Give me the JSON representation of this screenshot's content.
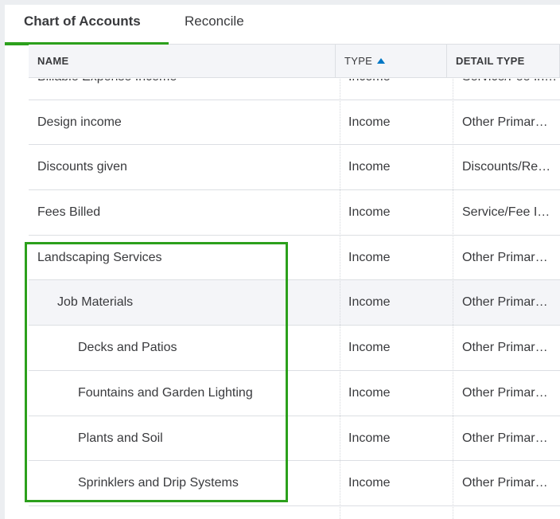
{
  "tabs": [
    {
      "label": "Chart of Accounts"
    },
    {
      "label": "Reconcile"
    }
  ],
  "table": {
    "columns": {
      "name": "NAME",
      "type": "TYPE",
      "detail_type": "DETAIL TYPE"
    },
    "rows": [
      {
        "name": "Billable Expense Income",
        "type": "Income",
        "detail": "Service/Fee Income"
      },
      {
        "name": "Design income",
        "type": "Income",
        "detail": "Other Primar…"
      },
      {
        "name": "Discounts given",
        "type": "Income",
        "detail": "Discounts/Re…"
      },
      {
        "name": "Fees Billed",
        "type": "Income",
        "detail": "Service/Fee I…"
      },
      {
        "name": "Landscaping Services",
        "type": "Income",
        "detail": "Other Primar…"
      },
      {
        "name": "Job Materials",
        "type": "Income",
        "detail": "Other Primar…"
      },
      {
        "name": "Decks and Patios",
        "type": "Income",
        "detail": "Other Primar…"
      },
      {
        "name": "Fountains and Garden Lighting",
        "type": "Income",
        "detail": "Other Primar…"
      },
      {
        "name": "Plants and Soil",
        "type": "Income",
        "detail": "Other Primar…"
      },
      {
        "name": "Sprinklers and Drip Systems",
        "type": "Income",
        "detail": "Other Primar…"
      }
    ]
  },
  "colors": {
    "accent": "#2ca01c",
    "sort_arrow": "#0077c5",
    "hover_row": "#f4f5f8"
  },
  "icons": {
    "sort": "sort-ascending-icon"
  }
}
